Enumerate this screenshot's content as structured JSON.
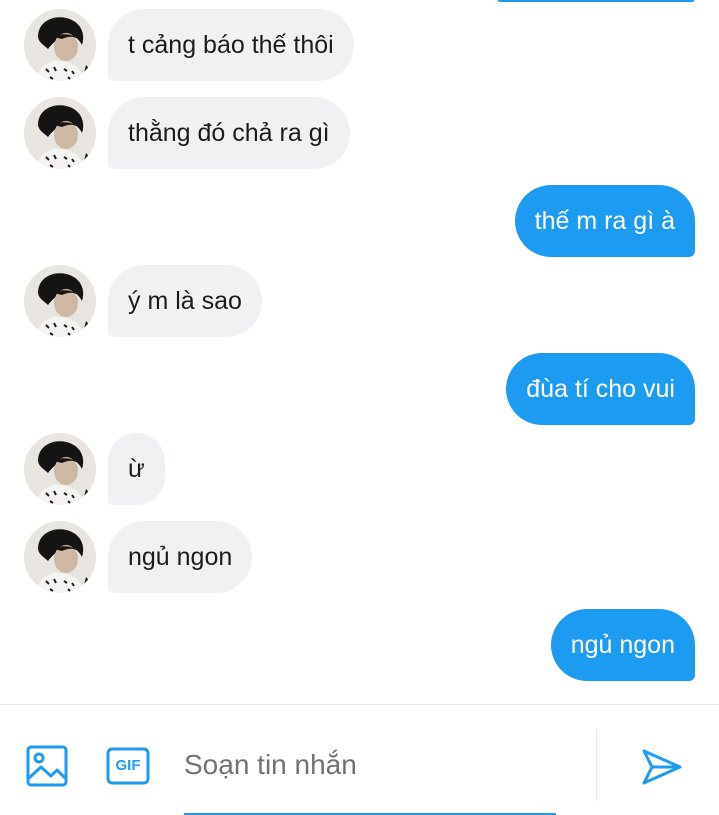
{
  "conversation": {
    "messages": [
      {
        "direction": "in",
        "text": "t cảng báo thế thôi"
      },
      {
        "direction": "in",
        "text": "thằng đó chả ra gì"
      },
      {
        "direction": "out",
        "text": "thế m ra gì à"
      },
      {
        "direction": "in",
        "text": "ý m là sao"
      },
      {
        "direction": "out",
        "text": "đùa tí cho vui"
      },
      {
        "direction": "in",
        "text": "ừ"
      },
      {
        "direction": "in",
        "text": "ngủ ngon"
      },
      {
        "direction": "out",
        "text": "ngủ ngon"
      }
    ]
  },
  "composer": {
    "placeholder": "Soạn tin nhắn",
    "value": "",
    "gif_label": "GIF",
    "icons": {
      "image": "image-icon",
      "gif": "gif-icon",
      "send": "send-icon"
    }
  },
  "colors": {
    "accent": "#1d9bf0",
    "incoming_bubble": "#eff1f3",
    "incoming_text": "#1c1c1c",
    "outgoing_text": "#ffffff"
  }
}
